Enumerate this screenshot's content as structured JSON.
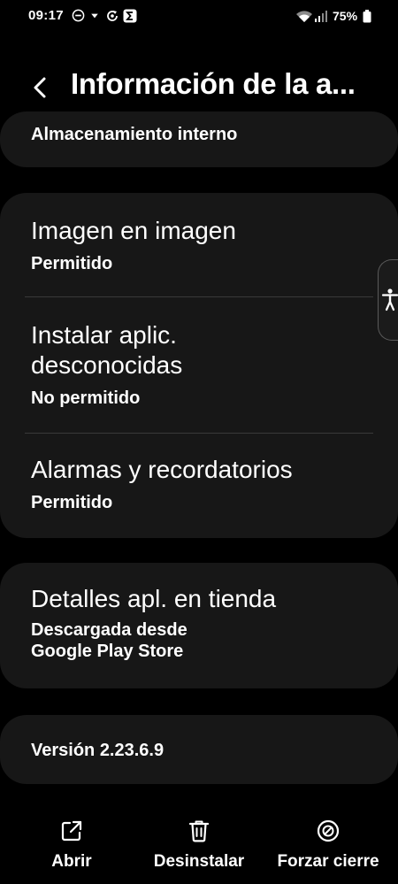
{
  "status_bar": {
    "time": "09:17",
    "battery_percent": "75%",
    "icons": [
      "do-not-disturb-icon",
      "download-arrow-icon",
      "sync-icon",
      "sigma-app-icon",
      "wifi-icon",
      "cell-signal-icon",
      "battery-icon"
    ]
  },
  "header": {
    "back_icon": "chevron-left-icon",
    "title": "Información de la a..."
  },
  "sections": {
    "storage": {
      "label": "Almacenamiento interno"
    },
    "permissions": [
      {
        "title": "Imagen en imagen",
        "value": "Permitido"
      },
      {
        "title": "Instalar aplic. desconocidas",
        "value": "No permitido"
      },
      {
        "title": "Alarmas y recordatorios",
        "value": "Permitido"
      }
    ],
    "store": {
      "title": "Detalles apl. en tienda",
      "subtitle": "Descargada desde Google Play Store"
    },
    "version": {
      "label": "Versión 2.23.6.9"
    }
  },
  "accessibility_handle": {
    "icon": "accessibility-person-icon"
  },
  "bottom_actions": {
    "open": {
      "label": "Abrir",
      "icon": "open-external-icon"
    },
    "uninstall": {
      "label": "Desinstalar",
      "icon": "trash-icon"
    },
    "force_stop": {
      "label": "Forzar cierre",
      "icon": "force-stop-icon"
    }
  },
  "colors": {
    "background": "#000000",
    "card": "#171717",
    "text": "#ffffff",
    "divider": "#3a3a3a"
  }
}
